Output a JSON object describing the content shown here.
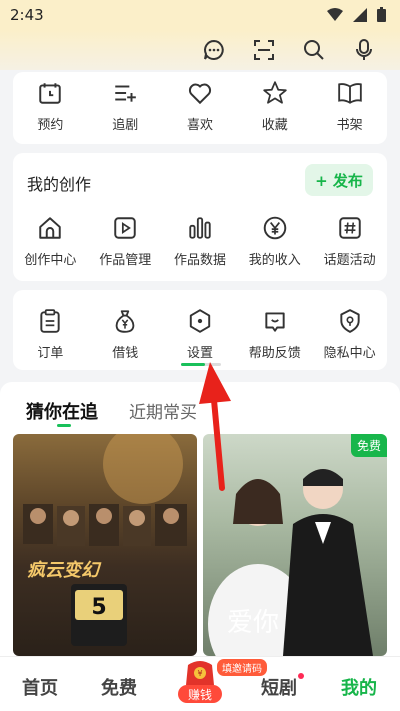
{
  "status": {
    "time": "2:43"
  },
  "header": {
    "icons": [
      "chat-icon",
      "scan-icon",
      "search-icon",
      "mic-icon"
    ]
  },
  "quick_row": {
    "items": [
      {
        "label": "预约",
        "icon": "calendar-icon"
      },
      {
        "label": "追剧",
        "icon": "follow-list-icon"
      },
      {
        "label": "喜欢",
        "icon": "heart-icon"
      },
      {
        "label": "收藏",
        "icon": "star-icon"
      },
      {
        "label": "书架",
        "icon": "book-icon"
      }
    ]
  },
  "creation": {
    "title": "我的创作",
    "publish_label": "+ 发布",
    "items": [
      {
        "label": "创作中心",
        "icon": "home-icon"
      },
      {
        "label": "作品管理",
        "icon": "video-manage-icon"
      },
      {
        "label": "作品数据",
        "icon": "bar-data-icon"
      },
      {
        "label": "我的收入",
        "icon": "yen-icon"
      },
      {
        "label": "话题活动",
        "icon": "hashtag-icon"
      }
    ]
  },
  "service": {
    "items": [
      {
        "label": "订单",
        "icon": "clipboard-icon"
      },
      {
        "label": "借钱",
        "icon": "money-bag-icon"
      },
      {
        "label": "设置",
        "icon": "settings-hexagon-icon"
      },
      {
        "label": "帮助反馈",
        "icon": "feedback-icon"
      },
      {
        "label": "隐私中心",
        "icon": "privacy-shield-icon"
      }
    ]
  },
  "feed_tabs": {
    "active": "猜你在追",
    "other": "近期常买"
  },
  "posters": [
    {
      "text": "疯云变幻",
      "badge": ""
    },
    {
      "text": "爱你",
      "badge": "免费"
    }
  ],
  "bottom_nav": {
    "home": "首页",
    "free": "免费",
    "earn": "赚钱",
    "earn_tag": "填邀请码",
    "short": "短剧",
    "mine": "我的"
  },
  "colors": {
    "accent": "#17b54a",
    "header": "#fbefc9",
    "annotation_arrow": "#e8221b"
  }
}
